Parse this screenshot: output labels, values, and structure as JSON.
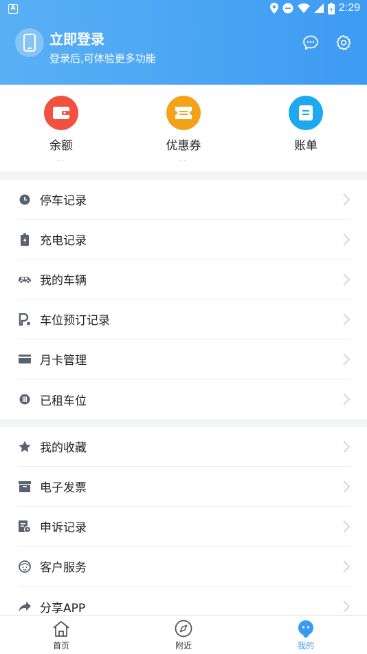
{
  "status_bar": {
    "time": "2:29",
    "app_badge": "A"
  },
  "header": {
    "title": "立即登录",
    "subtitle": "登录后,可体验更多功能"
  },
  "quick_actions": [
    {
      "label": "余额",
      "value": "--",
      "icon": "wallet-icon",
      "color": "#f0523f"
    },
    {
      "label": "优惠券",
      "value": "--",
      "icon": "coupon-icon",
      "color": "#f5a21b"
    },
    {
      "label": "账单",
      "value": "",
      "icon": "bill-icon",
      "color": "#1ea9ee"
    }
  ],
  "menu_group_1": [
    {
      "label": "停车记录",
      "icon": "clock-icon"
    },
    {
      "label": "充电记录",
      "icon": "battery-icon"
    },
    {
      "label": "我的车辆",
      "icon": "car-icon"
    },
    {
      "label": "车位预订记录",
      "icon": "parking-icon"
    },
    {
      "label": "月卡管理",
      "icon": "card-icon"
    },
    {
      "label": "已租车位",
      "icon": "rented-icon"
    }
  ],
  "menu_group_2": [
    {
      "label": "我的收藏",
      "icon": "star-icon"
    },
    {
      "label": "电子发票",
      "icon": "invoice-icon"
    },
    {
      "label": "申诉记录",
      "icon": "appeal-icon"
    },
    {
      "label": "客户服务",
      "icon": "customer-service-icon"
    },
    {
      "label": "分享APP",
      "icon": "share-icon"
    }
  ],
  "tabs": [
    {
      "label": "首页",
      "icon": "home-icon"
    },
    {
      "label": "附近",
      "icon": "compass-icon"
    },
    {
      "label": "我的",
      "icon": "profile-icon",
      "active": true
    }
  ],
  "colors": {
    "accent": "#3a9af2",
    "icon_gray": "#5a6270"
  }
}
